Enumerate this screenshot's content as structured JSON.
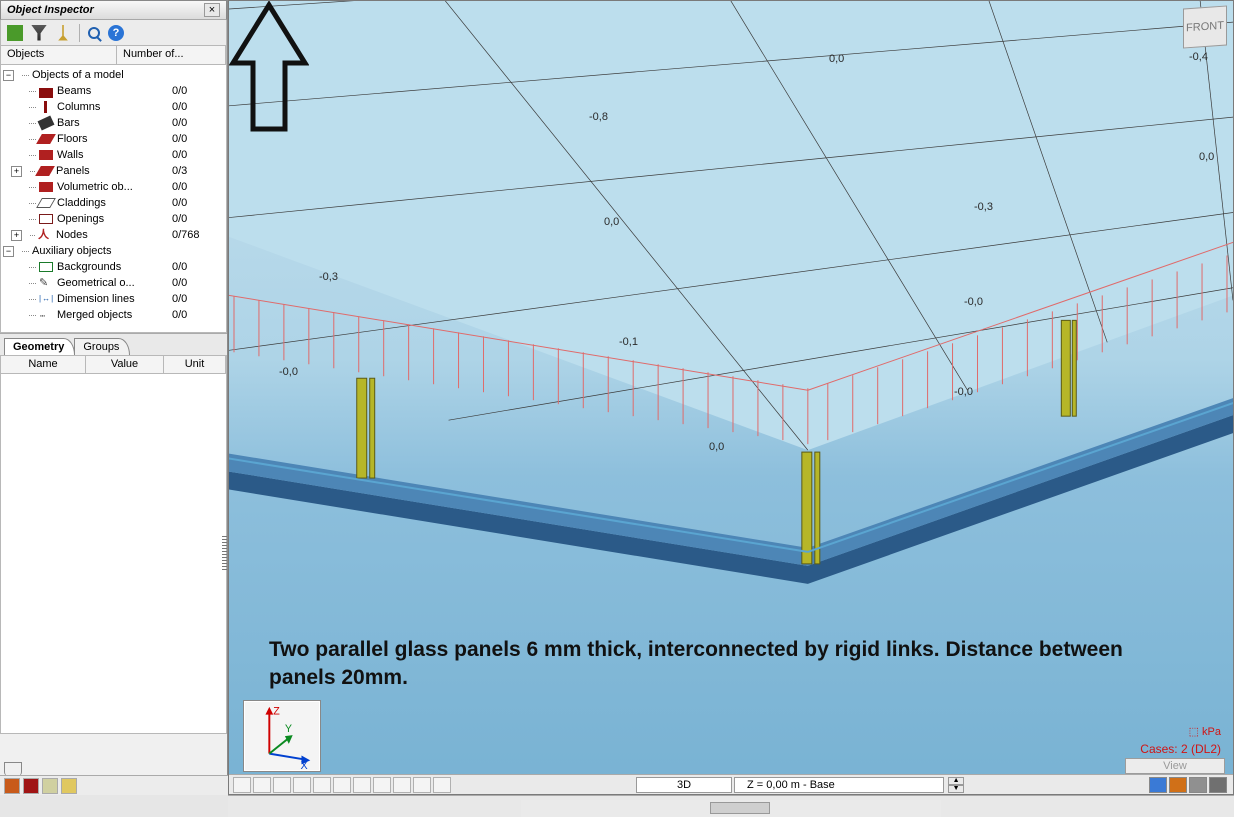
{
  "panel": {
    "title": "Object  Inspector",
    "header_cols": {
      "objects": "Objects",
      "number": "Number of..."
    },
    "root": {
      "model_label": "Objects of a model",
      "aux_label": "Auxiliary objects"
    },
    "items": [
      {
        "label": "Beams",
        "count": "0/0",
        "icon": "beam"
      },
      {
        "label": "Columns",
        "count": "0/0",
        "icon": "col"
      },
      {
        "label": "Bars",
        "count": "0/0",
        "icon": "bar"
      },
      {
        "label": "Floors",
        "count": "0/0",
        "icon": "floor"
      },
      {
        "label": "Walls",
        "count": "0/0",
        "icon": "wall"
      },
      {
        "label": "Panels",
        "count": "0/3",
        "icon": "panel",
        "expandable": true
      },
      {
        "label": "Volumetric ob...",
        "count": "0/0",
        "icon": "vol"
      },
      {
        "label": "Claddings",
        "count": "0/0",
        "icon": "clad"
      },
      {
        "label": "Openings",
        "count": "0/0",
        "icon": "open"
      },
      {
        "label": "Nodes",
        "count": "0/768",
        "icon": "node",
        "expandable": true
      }
    ],
    "aux_items": [
      {
        "label": "Backgrounds",
        "count": "0/0",
        "icon": "bg"
      },
      {
        "label": "Geometrical o...",
        "count": "0/0",
        "icon": "geo"
      },
      {
        "label": "Dimension lines",
        "count": "0/0",
        "icon": "dim"
      },
      {
        "label": "Merged objects",
        "count": "0/0",
        "icon": "merge"
      }
    ],
    "tabs": {
      "geometry": "Geometry",
      "groups": "Groups"
    },
    "prop_cols": {
      "name": "Name",
      "value": "Value",
      "unit": "Unit"
    }
  },
  "viewport": {
    "cube": "FRONT",
    "dims": {
      "d1": "0,0",
      "d2": "-0,4",
      "d3": "-0,8",
      "d4": "0,0",
      "d5": "0,0",
      "d6": "-0,3",
      "d7": "-0,3",
      "d8": "-0,0",
      "d9": "-0,1",
      "d10": "-0,0",
      "d11": "0,0",
      "d12": "-0,0"
    },
    "annotation": "Two parallel glass panels 6 mm thick, interconnected by rigid links. Distance between panels 20mm.",
    "unit_label": "kPa",
    "case_label": "Cases: 2 (DL2)",
    "view_label": "View",
    "axes": {
      "x": "X",
      "y": "Y",
      "z": "Z"
    },
    "bottom": {
      "view3d": "3D",
      "coord": "Z = 0,00 m - Base"
    }
  }
}
